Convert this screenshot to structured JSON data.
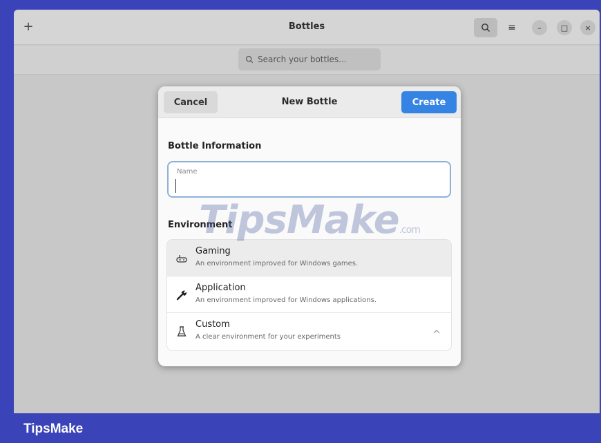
{
  "window": {
    "title": "Bottles",
    "add_label": "+",
    "menu_label": "≡",
    "min_label": "–",
    "max_label": "□",
    "close_label": "×"
  },
  "search": {
    "placeholder": "Search your bottles..."
  },
  "dialog": {
    "title": "New Bottle",
    "cancel_label": "Cancel",
    "create_label": "Create",
    "info_section": "Bottle Information",
    "name_label": "Name",
    "name_value": "",
    "env_section": "Environment",
    "environments": [
      {
        "title": "Gaming",
        "subtitle": "An environment improved for Windows games.",
        "icon": "gamepad-icon",
        "selected": true
      },
      {
        "title": "Application",
        "subtitle": "An environment improved for Windows applications.",
        "icon": "wrench-icon",
        "selected": false
      },
      {
        "title": "Custom",
        "subtitle": "A clear environment for your experiments",
        "icon": "flask-icon",
        "selected": false
      }
    ]
  },
  "watermark": {
    "text": "TipsMake",
    "suffix": ".com"
  },
  "footer": {
    "brand": "TipsMake"
  },
  "colors": {
    "accent": "#3584e4",
    "frame": "#3a44b8"
  }
}
